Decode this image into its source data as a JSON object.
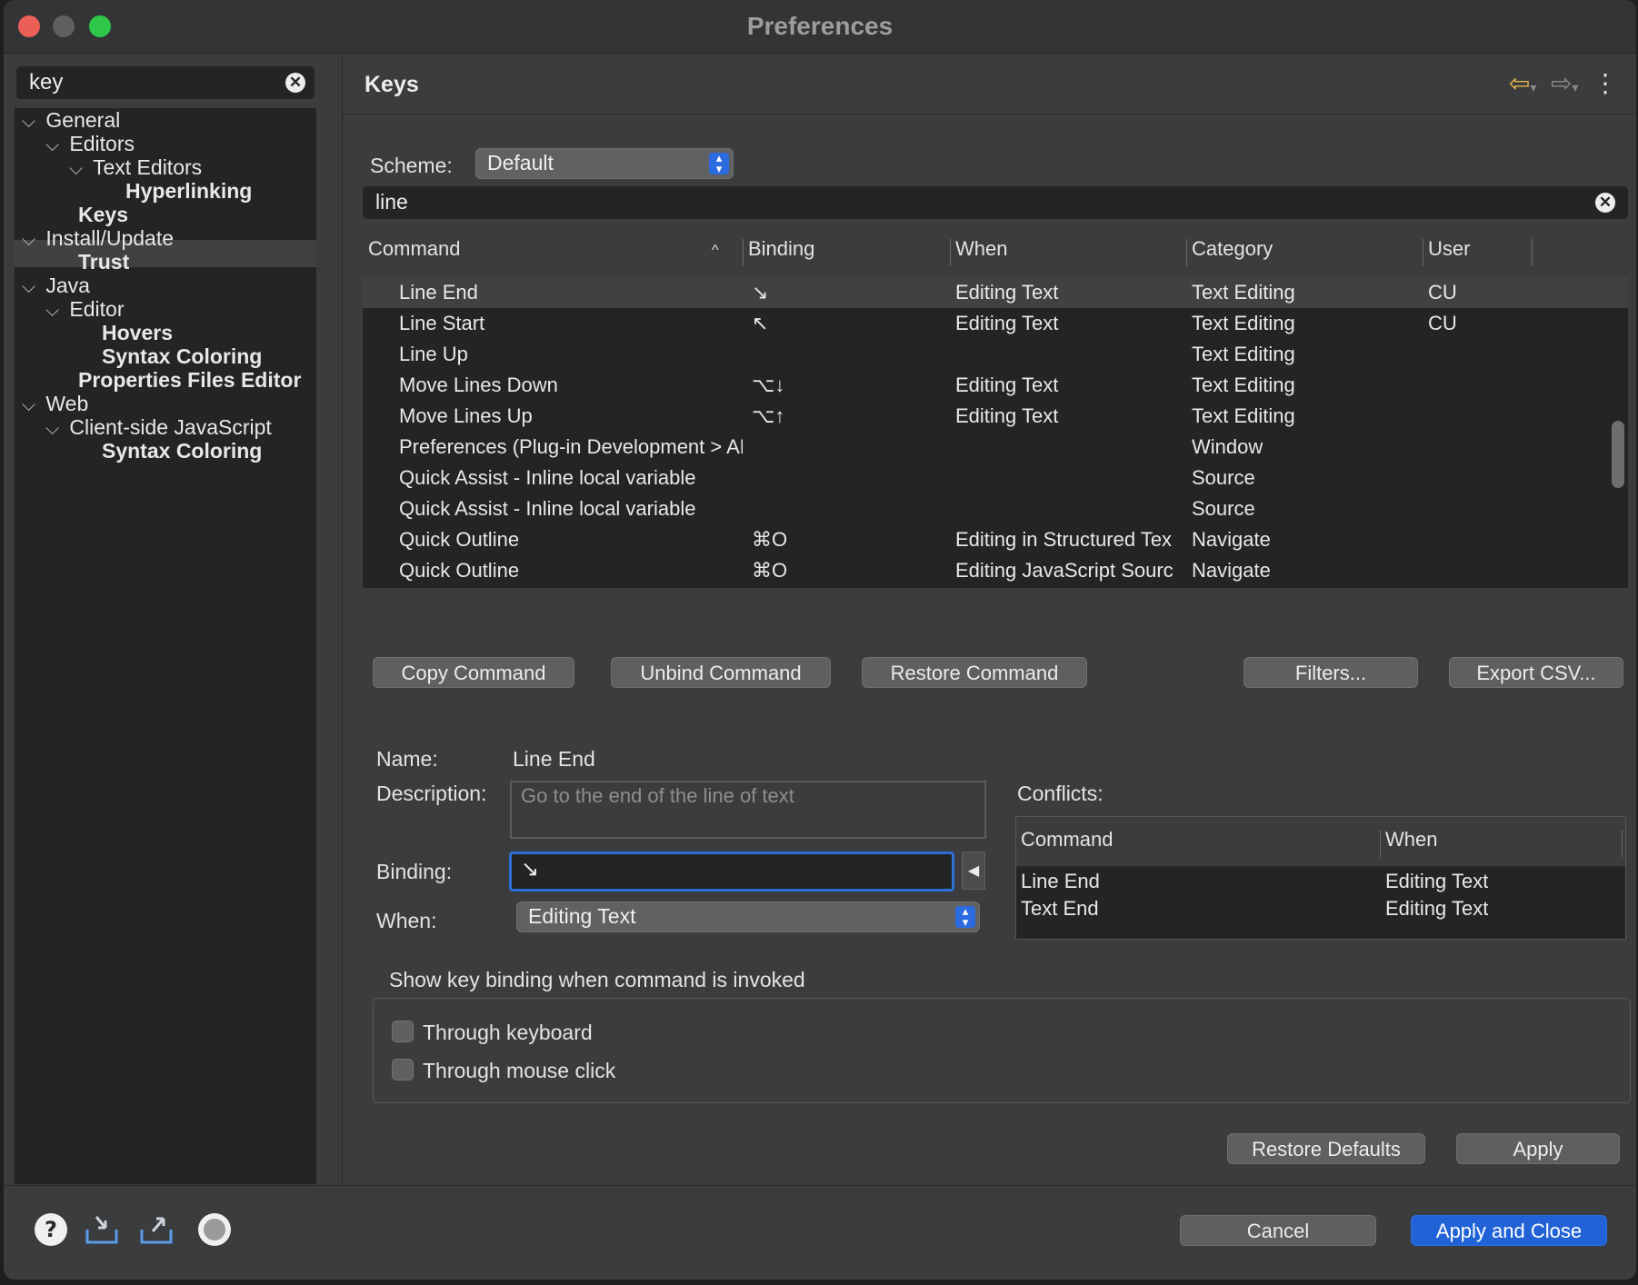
{
  "window": {
    "title": "Preferences"
  },
  "sidebar": {
    "search_value": "key",
    "tree": [
      {
        "label": "General",
        "level": 0,
        "expanded": true,
        "bold": false
      },
      {
        "label": "Editors",
        "level": 1,
        "expanded": true,
        "bold": false
      },
      {
        "label": "Text Editors",
        "level": 2,
        "expanded": true,
        "bold": false
      },
      {
        "label": "Hyperlinking",
        "level": 3,
        "bold": true
      },
      {
        "label": "Keys",
        "level": 1,
        "bold": true,
        "selected": true
      },
      {
        "label": "Install/Update",
        "level": 0,
        "expanded": true,
        "bold": false
      },
      {
        "label": "Trust",
        "level": 1,
        "bold": true
      },
      {
        "label": "Java",
        "level": 0,
        "expanded": true,
        "bold": false
      },
      {
        "label": "Editor",
        "level": 1,
        "expanded": true,
        "bold": false
      },
      {
        "label": "Hovers",
        "level": 2,
        "bold": true
      },
      {
        "label": "Syntax Coloring",
        "level": 2,
        "bold": true
      },
      {
        "label": "Properties Files Editor",
        "level": 1,
        "bold": true
      },
      {
        "label": "Web",
        "level": 0,
        "expanded": true,
        "bold": false
      },
      {
        "label": "Client-side JavaScript",
        "level": 1,
        "expanded": true,
        "bold": false
      },
      {
        "label": "Syntax Coloring",
        "level": 2,
        "bold": true
      }
    ]
  },
  "page": {
    "title": "Keys"
  },
  "scheme": {
    "label": "Scheme:",
    "value": "Default"
  },
  "filter": {
    "value": "line"
  },
  "table": {
    "columns": [
      "Command",
      "Binding",
      "When",
      "Category",
      "User"
    ],
    "rows": [
      {
        "command": "Line End",
        "binding": "↘",
        "when": "Editing Text",
        "category": "Text Editing",
        "user": "CU",
        "selected": true
      },
      {
        "command": "Line Start",
        "binding": "↖",
        "when": "Editing Text",
        "category": "Text Editing",
        "user": "CU"
      },
      {
        "command": "Line Up",
        "binding": "",
        "when": "",
        "category": "Text Editing",
        "user": ""
      },
      {
        "command": "Move Lines Down",
        "binding": "⌥↓",
        "when": "Editing Text",
        "category": "Text Editing",
        "user": ""
      },
      {
        "command": "Move Lines Up",
        "binding": "⌥↑",
        "when": "Editing Text",
        "category": "Text Editing",
        "user": ""
      },
      {
        "command": "Preferences (Plug-in Development > API E",
        "binding": "",
        "when": "",
        "category": "Window",
        "user": ""
      },
      {
        "command": "Quick Assist - Inline local variable",
        "binding": "",
        "when": "",
        "category": "Source",
        "user": ""
      },
      {
        "command": "Quick Assist - Inline local variable",
        "binding": "",
        "when": "",
        "category": "Source",
        "user": ""
      },
      {
        "command": "Quick Outline",
        "binding": "⌘O",
        "when": "Editing in Structured Tex",
        "category": "Navigate",
        "user": ""
      },
      {
        "command": "Quick Outline",
        "binding": "⌘O",
        "when": "Editing JavaScript Sourc",
        "category": "Navigate",
        "user": ""
      }
    ]
  },
  "actions": {
    "copy": "Copy Command",
    "unbind": "Unbind Command",
    "restore": "Restore Command",
    "filters": "Filters...",
    "export": "Export CSV..."
  },
  "details": {
    "name_label": "Name:",
    "name_value": "Line End",
    "description_label": "Description:",
    "description_value": "Go to the end of the line of text",
    "binding_label": "Binding:",
    "binding_value": "↘",
    "when_label": "When:",
    "when_value": "Editing Text"
  },
  "conflicts": {
    "label": "Conflicts:",
    "columns": [
      "Command",
      "When"
    ],
    "rows": [
      {
        "command": "Line End",
        "when": "Editing Text"
      },
      {
        "command": "Text End",
        "when": "Editing Text"
      }
    ]
  },
  "show_binding": {
    "title": "Show key binding when command is invoked",
    "keyboard": "Through keyboard",
    "mouse": "Through mouse click"
  },
  "bottom": {
    "restore_defaults": "Restore Defaults",
    "apply": "Apply",
    "cancel": "Cancel",
    "apply_close": "Apply and Close"
  }
}
